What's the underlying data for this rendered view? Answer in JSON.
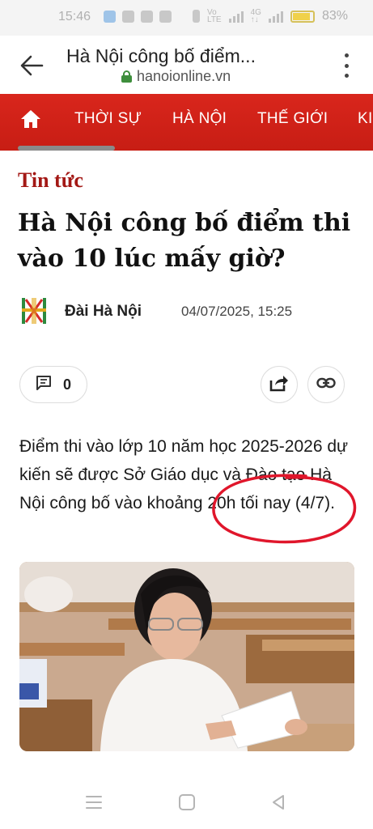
{
  "status_bar": {
    "time": "15:46",
    "battery": "83%"
  },
  "browser": {
    "page_title": "Hà Nội công bố điểm...",
    "url": "hanoionline.vn"
  },
  "nav": {
    "items": [
      "THỜI SỰ",
      "HÀ NỘI",
      "THẾ GIỚI",
      "KI"
    ]
  },
  "article": {
    "category": "Tin tức",
    "headline": "Hà Nội công bố điểm thi vào 10 lúc mấy giờ?",
    "author": "Đài Hà Nội",
    "date": "04/07/2025, 15:25",
    "comment_count": "0",
    "body": "Điểm thi vào lớp 10 năm học 2025-2026 dự kiến sẽ được Sở Giáo dục và Đào tạo Hà Nội công bố vào khoảng 20h tối nay (4/7)."
  },
  "icons": {
    "back": "back-arrow-icon",
    "menu": "more-vert-icon",
    "lock": "lock-icon",
    "home": "home-icon",
    "comment": "comment-icon",
    "share": "share-icon",
    "link": "link-icon"
  },
  "colors": {
    "brand_red": "#d9261c",
    "category_red": "#a31815",
    "annotation_red": "#e0162b",
    "url_lock_green": "#3e8e3c"
  }
}
